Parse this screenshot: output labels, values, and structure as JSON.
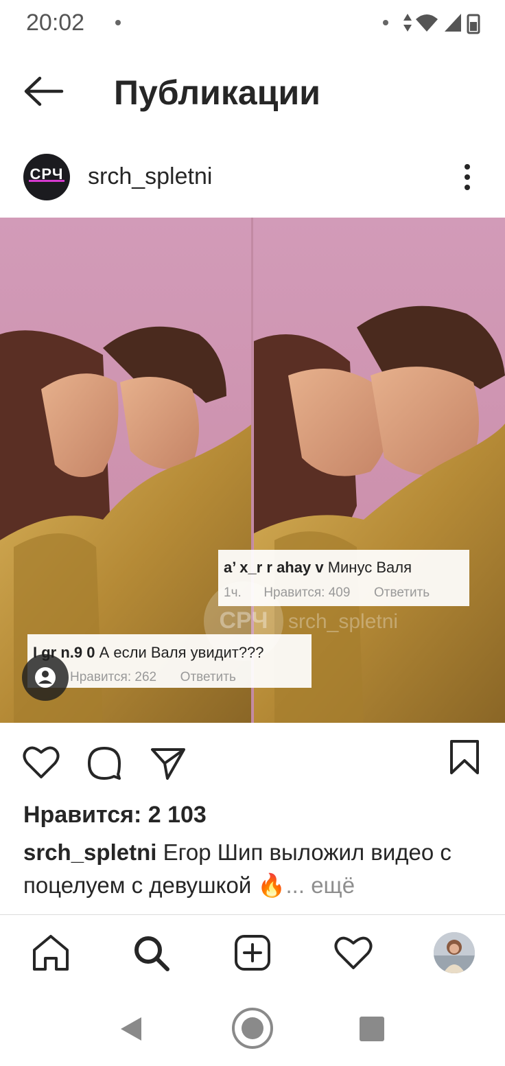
{
  "status_bar": {
    "time": "20:02"
  },
  "header": {
    "title": "Публикации"
  },
  "post": {
    "username": "srch_spletni",
    "avatar_text": "СРЧ",
    "watermark_logo": "СРЧ",
    "watermark_handle": "srch_spletni",
    "comment_1": {
      "user": "a’ x_r  r  ahay  v",
      "text": "Минус Валя",
      "time": "1ч.",
      "likes": "Нравится: 409",
      "reply": "Ответить"
    },
    "comment_2": {
      "user": "I gr  n.9  0",
      "text": "А если Валя увидит???",
      "likes": "Нравится: 262",
      "reply": "Ответить"
    },
    "likes_text": "Нравится: 2 103",
    "caption": {
      "username": "srch_spletni",
      "text": "Егор Шип выложил видео с поцелуем с девушкой 🔥",
      "more": "... ещё"
    }
  },
  "icons": {
    "back": "arrow-left-icon",
    "more": "more-vertical-icon",
    "like": "heart-icon",
    "comment": "comment-icon",
    "share": "send-icon",
    "save": "bookmark-icon",
    "user_tags": "user-tag-icon",
    "nav": [
      "home-icon",
      "search-icon",
      "add-icon",
      "activity-icon",
      "profile-icon"
    ]
  },
  "colors": {
    "text": "#262626",
    "secondary": "#8e8e8e",
    "media_bg": "#d8a2b8"
  }
}
